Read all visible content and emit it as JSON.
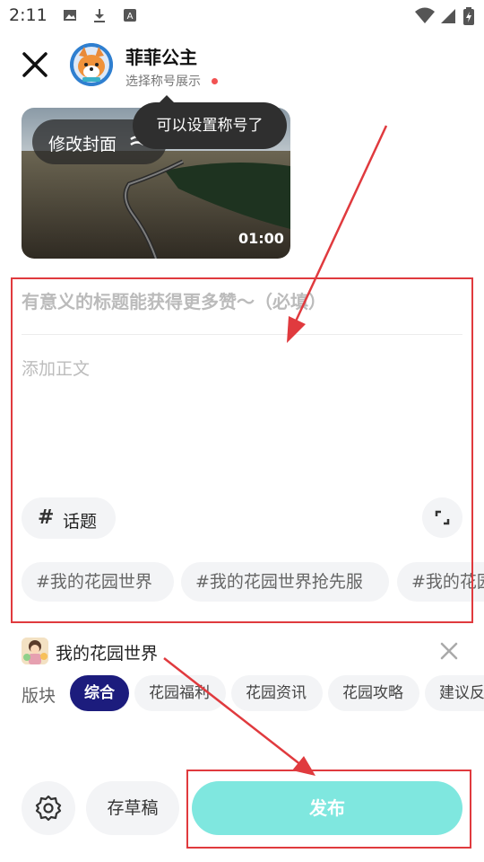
{
  "status_bar": {
    "time": "2:11"
  },
  "header": {
    "username": "菲菲公主",
    "title_select": "选择称号展示"
  },
  "cover": {
    "edit_label": "修改封面",
    "duration": "01:00"
  },
  "tooltip": {
    "text": "可以设置称号了"
  },
  "editor": {
    "title_placeholder": "有意义的标题能获得更多赞～（必填）",
    "body_placeholder": "添加正文",
    "topic_label": "话题",
    "topic_chips": [
      "#我的花园世界",
      "#我的花园世界抢先服",
      "#我的花园"
    ]
  },
  "game": {
    "name": "我的花园世界"
  },
  "board": {
    "label": "版块",
    "tabs": [
      {
        "label": "综合",
        "active": true
      },
      {
        "label": "花园福利",
        "active": false
      },
      {
        "label": "花园资讯",
        "active": false
      },
      {
        "label": "花园攻略",
        "active": false
      },
      {
        "label": "建议反",
        "active": false
      }
    ]
  },
  "footer": {
    "draft_label": "存草稿",
    "publish_label": "发布"
  },
  "colors": {
    "accent": "#7fe7df",
    "active_tab": "#1c1c7d",
    "annotation": "#e03a3e"
  }
}
